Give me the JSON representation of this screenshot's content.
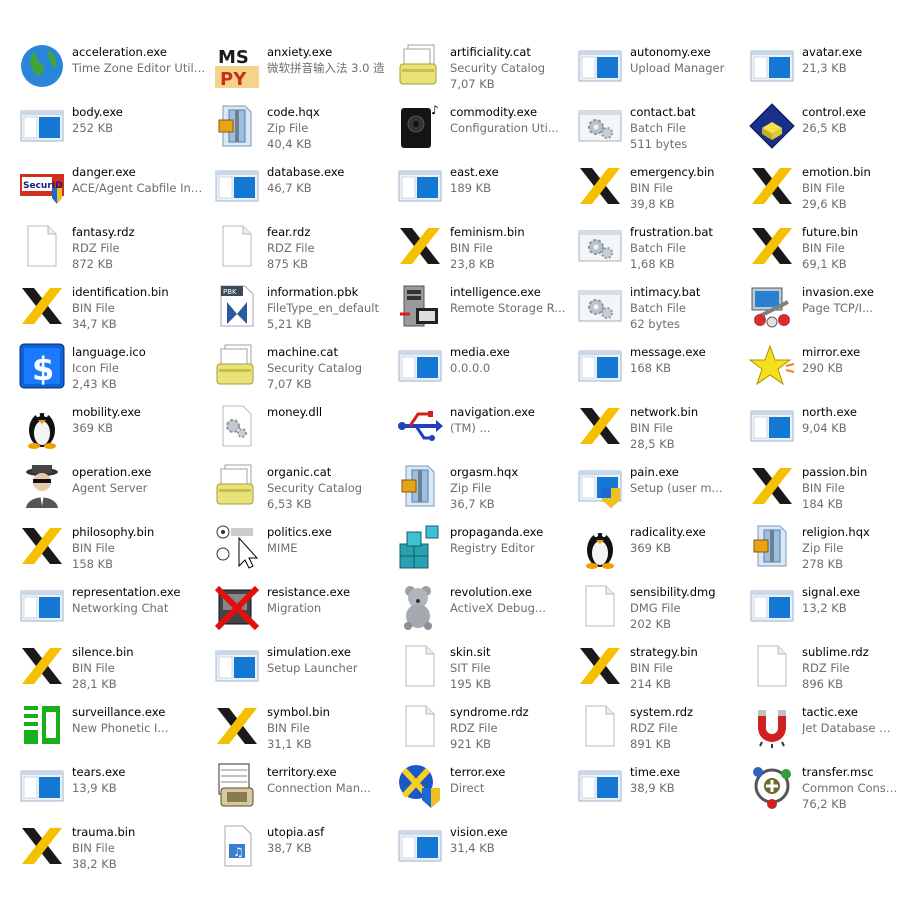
{
  "files": [
    {
      "name": "acceleration.exe",
      "line2": "Time Zone Editor Utility",
      "line3": "",
      "icon": "globe-icon"
    },
    {
      "name": "anxiety.exe",
      "line2": "微软拼音输入法 3.0 造",
      "line3": "",
      "icon": "mspy-icon"
    },
    {
      "name": "artificiality.cat",
      "line2": "Security Catalog",
      "line3": "7,07 KB",
      "icon": "catalog-icon"
    },
    {
      "name": "autonomy.exe",
      "line2": "Upload Manager",
      "line3": "",
      "icon": "window-app-icon"
    },
    {
      "name": "avatar.exe",
      "line2": "21,3 KB",
      "line3": "",
      "icon": "window-app-icon"
    },
    {
      "name": "body.exe",
      "line2": "252 KB",
      "line3": "",
      "icon": "window-app-icon"
    },
    {
      "name": "code.hqx",
      "line2": "Zip File",
      "line3": "40,4 KB",
      "icon": "zip-icon"
    },
    {
      "name": "commodity.exe",
      "line2": "Configuration Uti...",
      "line3": "",
      "icon": "speaker-icon"
    },
    {
      "name": "contact.bat",
      "line2": "Batch File",
      "line3": "511 bytes",
      "icon": "batch-gear-icon"
    },
    {
      "name": "control.exe",
      "line2": "26,5 KB",
      "line3": "",
      "icon": "control-panel-icon"
    },
    {
      "name": "danger.exe",
      "line2": "ACE/Agent Cabfile Install",
      "line3": "",
      "icon": "securid-icon"
    },
    {
      "name": "database.exe",
      "line2": "46,7 KB",
      "line3": "",
      "icon": "window-app-icon"
    },
    {
      "name": "east.exe",
      "line2": "189 KB",
      "line3": "",
      "icon": "window-app-icon"
    },
    {
      "name": "emergency.bin",
      "line2": "BIN File",
      "line3": "39,8 KB",
      "icon": "x-icon"
    },
    {
      "name": "emotion.bin",
      "line2": "BIN File",
      "line3": "29,6 KB",
      "icon": "x-icon"
    },
    {
      "name": "fantasy.rdz",
      "line2": "RDZ File",
      "line3": "872 KB",
      "icon": "blank-file-icon"
    },
    {
      "name": "fear.rdz",
      "line2": "RDZ File",
      "line3": "875 KB",
      "icon": "blank-file-icon"
    },
    {
      "name": "feminism.bin",
      "line2": "BIN File",
      "line3": "23,8 KB",
      "icon": "x-icon"
    },
    {
      "name": "frustration.bat",
      "line2": "Batch File",
      "line3": "1,68 KB",
      "icon": "batch-gear-icon"
    },
    {
      "name": "future.bin",
      "line2": "BIN File",
      "line3": "69,1 KB",
      "icon": "x-icon"
    },
    {
      "name": "identification.bin",
      "line2": "BIN File",
      "line3": "34,7 KB",
      "icon": "x-icon"
    },
    {
      "name": "information.pbk",
      "line2": "FileType_en_default",
      "line3": "5,21 KB",
      "icon": "pbk-icon"
    },
    {
      "name": "intelligence.exe",
      "line2": "Remote Storage Recall",
      "line3": "",
      "icon": "remote-storage-icon"
    },
    {
      "name": "intimacy.bat",
      "line2": "Batch File",
      "line3": "62 bytes",
      "icon": "batch-gear-icon"
    },
    {
      "name": "invasion.exe",
      "line2": "Page TCP/I...",
      "line3": "",
      "icon": "network-pc-icon"
    },
    {
      "name": "language.ico",
      "line2": "Icon File",
      "line3": "2,43 KB",
      "icon": "dollar-icon"
    },
    {
      "name": "machine.cat",
      "line2": "Security Catalog",
      "line3": "7,07 KB",
      "icon": "catalog-icon"
    },
    {
      "name": "media.exe",
      "line2": "0.0.0.0",
      "line3": "",
      "icon": "window-app-icon"
    },
    {
      "name": "message.exe",
      "line2": "168 KB",
      "line3": "",
      "icon": "window-app-icon"
    },
    {
      "name": "mirror.exe",
      "line2": "290 KB",
      "line3": "",
      "icon": "star-icon"
    },
    {
      "name": "mobility.exe",
      "line2": "369 KB",
      "line3": "",
      "icon": "penguin-icon"
    },
    {
      "name": "money.dll",
      "line2": "",
      "line3": "",
      "icon": "dll-gear-icon"
    },
    {
      "name": "navigation.exe",
      "line2": "(TM) ...",
      "line3": "",
      "icon": "usb-icon"
    },
    {
      "name": "network.bin",
      "line2": "BIN File",
      "line3": "28,5 KB",
      "icon": "x-icon"
    },
    {
      "name": "north.exe",
      "line2": "9,04 KB",
      "line3": "",
      "icon": "window-app-icon"
    },
    {
      "name": "operation.exe",
      "line2": "Agent Server",
      "line3": "",
      "icon": "agent-icon"
    },
    {
      "name": "organic.cat",
      "line2": "Security Catalog",
      "line3": "6,53 KB",
      "icon": "catalog-icon"
    },
    {
      "name": "orgasm.hqx",
      "line2": "Zip File",
      "line3": "36,7 KB",
      "icon": "zip-icon"
    },
    {
      "name": "pain.exe",
      "line2": "Setup (user m...",
      "line3": "",
      "icon": "window-shield-icon"
    },
    {
      "name": "passion.bin",
      "line2": "BIN File",
      "line3": "184 KB",
      "icon": "x-icon"
    },
    {
      "name": "philosophy.bin",
      "line2": "BIN File",
      "line3": "158 KB",
      "icon": "x-icon"
    },
    {
      "name": "politics.exe",
      "line2": "MIME",
      "line3": "",
      "icon": "mime-cursor-icon"
    },
    {
      "name": "propaganda.exe",
      "line2": "Registry Editor",
      "line3": "",
      "icon": "registry-icon"
    },
    {
      "name": "radicality.exe",
      "line2": "369 KB",
      "line3": "",
      "icon": "penguin-icon"
    },
    {
      "name": "religion.hqx",
      "line2": "Zip File",
      "line3": "278 KB",
      "icon": "zip-icon"
    },
    {
      "name": "representation.exe",
      "line2": "Networking Chat",
      "line3": "",
      "icon": "window-app-icon"
    },
    {
      "name": "resistance.exe",
      "line2": "Migration",
      "line3": "",
      "icon": "migration-icon"
    },
    {
      "name": "revolution.exe",
      "line2": "ActiveX Debug...",
      "line3": "",
      "icon": "teddy-bear-icon"
    },
    {
      "name": "sensibility.dmg",
      "line2": "DMG File",
      "line3": "202 KB",
      "icon": "blank-file-icon"
    },
    {
      "name": "signal.exe",
      "line2": "13,2 KB",
      "line3": "",
      "icon": "window-app-icon"
    },
    {
      "name": "silence.bin",
      "line2": "BIN File",
      "line3": "28,1 KB",
      "icon": "x-icon"
    },
    {
      "name": "simulation.exe",
      "line2": "Setup Launcher",
      "line3": "",
      "icon": "window-app-icon"
    },
    {
      "name": "skin.sit",
      "line2": "SIT File",
      "line3": "195 KB",
      "icon": "blank-file-icon"
    },
    {
      "name": "strategy.bin",
      "line2": "BIN File",
      "line3": "214 KB",
      "icon": "x-icon"
    },
    {
      "name": "sublime.rdz",
      "line2": "RDZ File",
      "line3": "896 KB",
      "icon": "blank-file-icon"
    },
    {
      "name": "surveillance.exe",
      "line2": "New Phonetic I...",
      "line3": "",
      "icon": "phonetic-icon"
    },
    {
      "name": "symbol.bin",
      "line2": "BIN File",
      "line3": "31,1 KB",
      "icon": "x-icon"
    },
    {
      "name": "syndrome.rdz",
      "line2": "RDZ File",
      "line3": "921 KB",
      "icon": "blank-file-icon"
    },
    {
      "name": "system.rdz",
      "line2": "RDZ File",
      "line3": "891 KB",
      "icon": "blank-file-icon"
    },
    {
      "name": "tactic.exe",
      "line2": "Jet Database Co...",
      "line3": "",
      "icon": "magnet-icon"
    },
    {
      "name": "tears.exe",
      "line2": "13,9 KB",
      "line3": "",
      "icon": "window-app-icon"
    },
    {
      "name": "territory.exe",
      "line2": "Connection Man...",
      "line3": "",
      "icon": "phone-book-icon"
    },
    {
      "name": "terror.exe",
      "line2": "Direct",
      "line3": "",
      "icon": "globe-shield-icon"
    },
    {
      "name": "time.exe",
      "line2": "38,9 KB",
      "line3": "",
      "icon": "window-app-icon"
    },
    {
      "name": "transfer.msc",
      "line2": "Common Conso...",
      "line3": "76,2 KB",
      "icon": "console-icon"
    },
    {
      "name": "trauma.bin",
      "line2": "BIN File",
      "line3": "38,2 KB",
      "icon": "x-icon"
    },
    {
      "name": "utopia.asf",
      "line2": "38,7 KB",
      "line3": "",
      "icon": "media-file-icon"
    },
    {
      "name": "vision.exe",
      "line2": "31,4 KB",
      "line3": "",
      "icon": "window-app-icon"
    }
  ]
}
